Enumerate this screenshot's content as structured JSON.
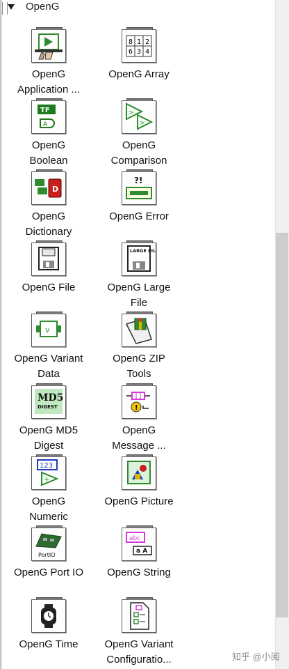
{
  "header": {
    "title": "OpenG"
  },
  "items": [
    {
      "label": "OpenG\nApplication ...",
      "icon": "application-control-icon"
    },
    {
      "label": "OpenG Array",
      "icon": "array-icon"
    },
    {
      "label": "OpenG\nBoolean",
      "icon": "boolean-icon"
    },
    {
      "label": "OpenG\nComparison",
      "icon": "comparison-icon"
    },
    {
      "label": "OpenG\nDictionary",
      "icon": "dictionary-icon"
    },
    {
      "label": "OpenG Error",
      "icon": "error-icon"
    },
    {
      "label": "OpenG File",
      "icon": "file-icon"
    },
    {
      "label": "OpenG Large\nFile",
      "icon": "large-file-icon"
    },
    {
      "label": "OpenG Variant\nData",
      "icon": "variant-data-icon"
    },
    {
      "label": "OpenG ZIP\nTools",
      "icon": "zip-tools-icon"
    },
    {
      "label": "OpenG MD5\nDigest",
      "icon": "md5-digest-icon"
    },
    {
      "label": "OpenG\nMessage ...",
      "icon": "message-queue-icon"
    },
    {
      "label": "OpenG\nNumeric",
      "icon": "numeric-icon"
    },
    {
      "label": "OpenG Picture",
      "icon": "picture-icon"
    },
    {
      "label": "OpenG Port IO",
      "icon": "port-io-icon"
    },
    {
      "label": "OpenG String",
      "icon": "string-icon"
    },
    {
      "label": "OpenG Time",
      "icon": "time-icon"
    },
    {
      "label": "OpenG Variant\nConfiguratio...",
      "icon": "variant-configuration-icon"
    }
  ],
  "icon_text": {
    "array": [
      "8",
      "1",
      "2",
      "6",
      "3",
      "4"
    ],
    "boolean_top": "TF",
    "dictionary": "D",
    "error": "?!",
    "large_file": "LARGE FILE",
    "md5_top": "MD5",
    "md5_bottom": "DIGEST",
    "numeric": "123",
    "port": "PortIO",
    "string_top": "abc",
    "string_bottom": "a A"
  },
  "watermark": "知乎 @小阅",
  "colors": {
    "background": "#ffffff",
    "scrollbar_thumb": "#cdcdcd",
    "icon_green": "#2e8b2e",
    "icon_blue": "#1f3fbf",
    "icon_pink": "#d23ad2",
    "icon_red": "#c81e1e"
  }
}
